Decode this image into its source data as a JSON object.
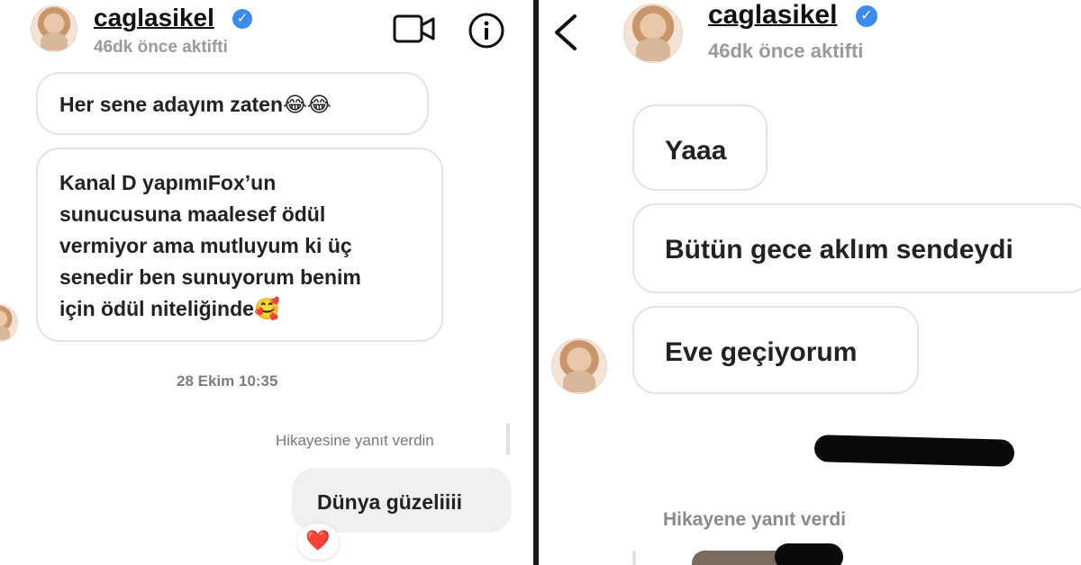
{
  "left": {
    "header": {
      "username": "caglasikel",
      "status": "46dk önce aktifti"
    },
    "messages": [
      {
        "text": "Her sene  adayım zaten",
        "emoji": "😂😂"
      },
      {
        "lines": [
          "Kanal D yapımıFox’un",
          "sunucusuna maalesef ödül",
          "vermiyor ama mutluyum ki üç",
          "senedir ben sunuyorum benim",
          "için ödül niteliğinde"
        ],
        "emoji": "🥰"
      }
    ],
    "timestamp": "28 Ekim 10:35",
    "reply_note": "Hikayesine yanıt verdin",
    "outgoing": "Dünya güzeliiii",
    "reaction": "❤️"
  },
  "right": {
    "header": {
      "username": "caglasikel",
      "status": "46dk önce aktifti"
    },
    "messages": [
      {
        "text": "Yaaa"
      },
      {
        "text": "Bütün gece aklım sendeydi"
      },
      {
        "text": "Eve geçiyorum"
      }
    ],
    "reply_note": "Hikayene yanıt verdi"
  },
  "colors": {
    "verified": "#3b8bef",
    "divider": "#1a1a1a",
    "bubble_border": "#e3e3e3",
    "outgoing_bg": "#f0f0f0"
  },
  "icons": [
    "verified-badge-icon",
    "video-call-icon",
    "info-icon",
    "back-chevron-icon",
    "heart-reaction-icon"
  ]
}
